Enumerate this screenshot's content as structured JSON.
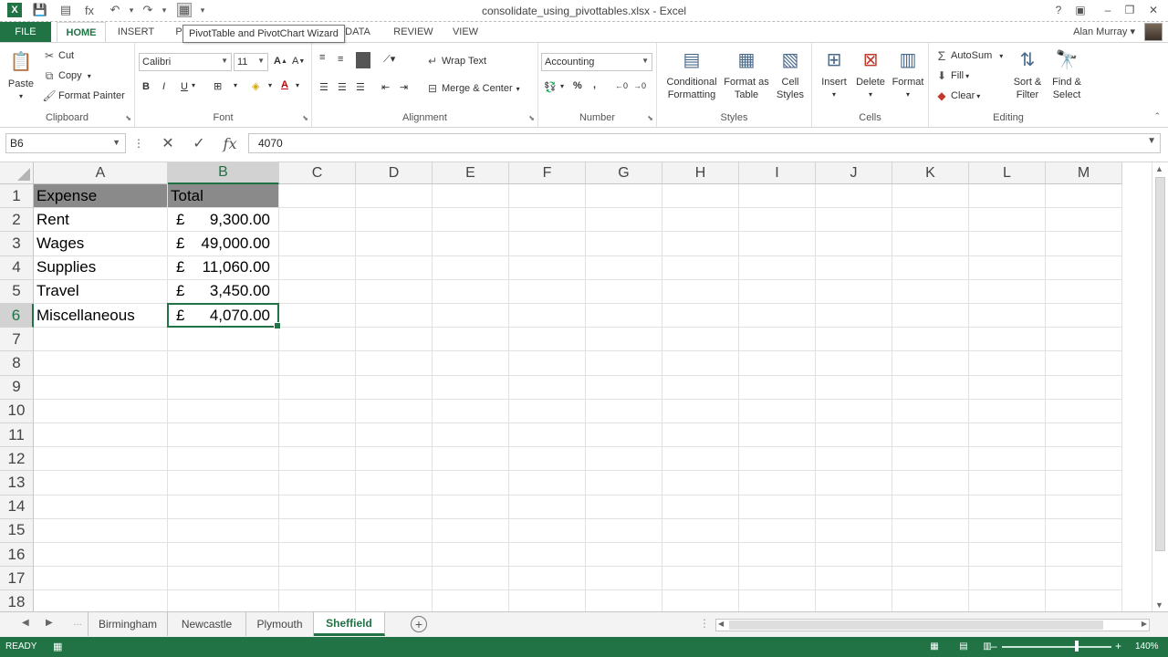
{
  "window": {
    "title": "consolidate_using_pivottables.xlsx - Excel",
    "help": "?",
    "restore_ribbon": "▣",
    "minimize": "–",
    "maximize": "❐",
    "close": "✕"
  },
  "qat": {
    "excel_icon": "X",
    "save_icon": "💾",
    "pivot_wizard_icon": "▦",
    "undo_icon": "↶",
    "redo_icon": "↷",
    "customize_icon": "▾"
  },
  "tooltip": "PivotTable and PivotChart Wizard",
  "tabs": {
    "file": "FILE",
    "items": [
      "HOME",
      "INSERT",
      "P",
      "DATA",
      "REVIEW",
      "VIEW"
    ],
    "active": "HOME"
  },
  "user": {
    "name": "Alan Murray",
    "caret": "▾"
  },
  "ribbon": {
    "clipboard": {
      "label": "Clipboard",
      "paste": "Paste",
      "cut": "Cut",
      "copy": "Copy",
      "format_painter": "Format Painter"
    },
    "font": {
      "label": "Font",
      "family": "Calibri",
      "size": "11",
      "grow": "A",
      "shrink": "A",
      "bold": "B",
      "italic": "I",
      "underline": "U"
    },
    "alignment": {
      "label": "Alignment",
      "wrap_text": "Wrap Text",
      "merge_center": "Merge & Center"
    },
    "number": {
      "label": "Number",
      "format": "Accounting",
      "percent": "%",
      "comma": ","
    },
    "styles": {
      "label": "Styles",
      "conditional_formatting": "Conditional Formatting",
      "format_as_table": "Format as Table",
      "cell_styles": "Cell Styles"
    },
    "cells": {
      "label": "Cells",
      "insert": "Insert",
      "delete": "Delete",
      "format": "Format"
    },
    "editing": {
      "label": "Editing",
      "autosum": "AutoSum",
      "fill": "Fill",
      "clear": "Clear",
      "sort_filter": "Sort & Filter",
      "find_select": "Find & Select"
    }
  },
  "formula_bar": {
    "name_box": "B6",
    "cancel": "✕",
    "enter": "✓",
    "fx": "fx",
    "value": "4070"
  },
  "grid": {
    "columns": [
      "A",
      "B",
      "C",
      "D",
      "E",
      "F",
      "G",
      "H",
      "I",
      "J",
      "K",
      "L",
      "M"
    ],
    "rows": [
      "1",
      "2",
      "3",
      "4",
      "5",
      "6",
      "7",
      "8",
      "9",
      "10",
      "11",
      "12",
      "13",
      "14",
      "15",
      "16",
      "17",
      "18"
    ],
    "selected_column": "B",
    "selected_row": "6",
    "cells": {
      "A1": "Expense",
      "B1": "Total",
      "A2": "Rent",
      "A3": "Wages",
      "A4": "Supplies",
      "A5": "Travel",
      "A6": "Miscellaneous"
    },
    "currency_symbol": "£",
    "amounts": {
      "B2": "9,300.00",
      "B3": "49,000.00",
      "B4": "11,060.00",
      "B5": "3,450.00",
      "B6": "4,070.00"
    }
  },
  "sheets": {
    "items": [
      "Birmingham",
      "Newcastle",
      "Plymouth",
      "Sheffield"
    ],
    "active": "Sheffield",
    "add": "+"
  },
  "status": {
    "mode": "READY",
    "zoom": "140%",
    "zoom_minus": "–",
    "zoom_plus": "+"
  },
  "colors": {
    "accent": "#217346",
    "header_fill": "#8a8a8a"
  }
}
